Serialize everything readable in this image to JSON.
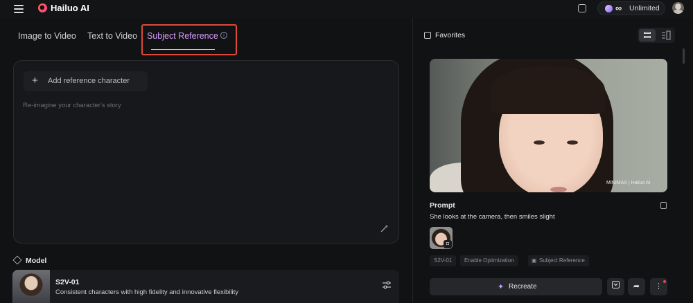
{
  "topbar": {
    "brand": "Hailuo AI",
    "plan_symbol": "∞",
    "plan_label": "Unlimited"
  },
  "left_panel": {
    "tabs": [
      {
        "label": "Image to Video",
        "active": false
      },
      {
        "label": "Text to Video",
        "active": false
      },
      {
        "label": "Subject Reference",
        "active": true
      }
    ],
    "add_reference_label": "Add reference character",
    "add_reference_symbol": "+",
    "prompt_placeholder": "Re-imagine your character's story",
    "model_section_title": "Model",
    "model": {
      "name": "S2V-01",
      "description": "Consistent characters with high fidelity and innovative flexibility"
    }
  },
  "right_panel": {
    "favorites_label": "Favorites",
    "video_watermark": "MINIMAX | Hailuo AI",
    "prompt_title": "Prompt",
    "prompt_text": "She looks at the camera, then smiles slight",
    "tags": [
      "S2V-01",
      "Enable Optimization",
      "Subject Reference"
    ],
    "recreate_label": "Recreate"
  },
  "colors": {
    "background": "#111214",
    "accent": "#d79cff",
    "highlight": "#e2483a"
  }
}
